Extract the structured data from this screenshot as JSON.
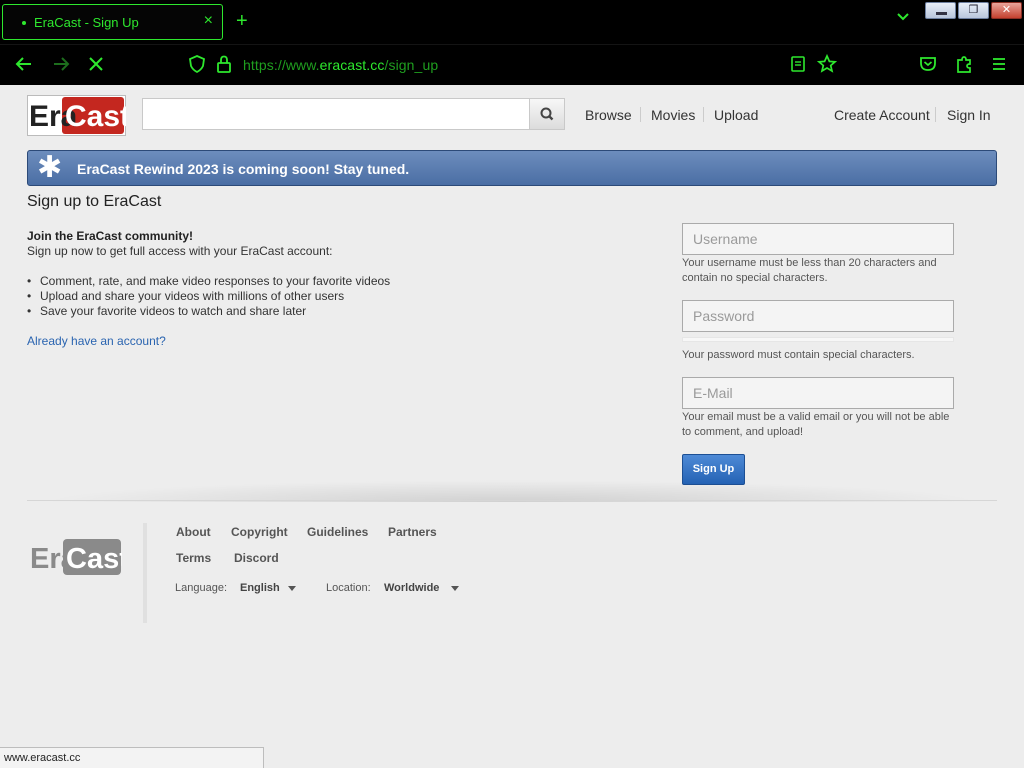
{
  "browser": {
    "tab": {
      "title": "EraCast - Sign Up",
      "close": "×"
    },
    "new_tab": "+",
    "window_buttons": {
      "restore": "❐",
      "close": "✕"
    },
    "url": {
      "prefix": "https://www.",
      "domain": "eracast.cc",
      "path": "/sign_up"
    },
    "status_text": "www.eracast.cc"
  },
  "header": {
    "logo": {
      "part1": "Era",
      "part2": "Cast"
    },
    "search": {
      "placeholder": ""
    },
    "nav": [
      "Browse",
      "Movies",
      "Upload"
    ],
    "account": {
      "create": "Create Account",
      "signin": "Sign In"
    }
  },
  "banner": {
    "star": "✱",
    "text": "EraCast Rewind 2023 is coming soon! Stay tuned."
  },
  "main": {
    "title": "Sign up to EraCast",
    "join": "Join the EraCast community!",
    "intro": "Sign up now to get full access with your EraCast account:",
    "bullets": [
      "Comment, rate, and make video responses to your favorite videos",
      "Upload and share your videos with millions of other users",
      "Save your favorite videos to watch and share later"
    ],
    "bullet_char": "•",
    "already": "Already have an account?"
  },
  "form": {
    "username": {
      "placeholder": "Username",
      "hint": "Your username must be less than 20 characters and contain no special characters."
    },
    "password": {
      "placeholder": "Password",
      "hint": "Your password must contain special characters."
    },
    "email": {
      "placeholder": "E-Mail",
      "hint": "Your email must be a valid email or you will not be able to comment, and upload!"
    },
    "submit": "Sign Up"
  },
  "footer": {
    "logo": {
      "part1": "Era",
      "part2": "Cast"
    },
    "links_row1": [
      "About",
      "Copyright",
      "Guidelines",
      "Partners"
    ],
    "links_row2": [
      "Terms",
      "Discord"
    ],
    "language_label": "Language:",
    "language_value": "English",
    "location_label": "Location:",
    "location_value": "Worldwide"
  },
  "colors": {
    "accent_green": "#2ee82e",
    "banner_blue": "#4a6ea4",
    "link_blue": "#2a64b0",
    "logo_red": "#c4271f"
  }
}
